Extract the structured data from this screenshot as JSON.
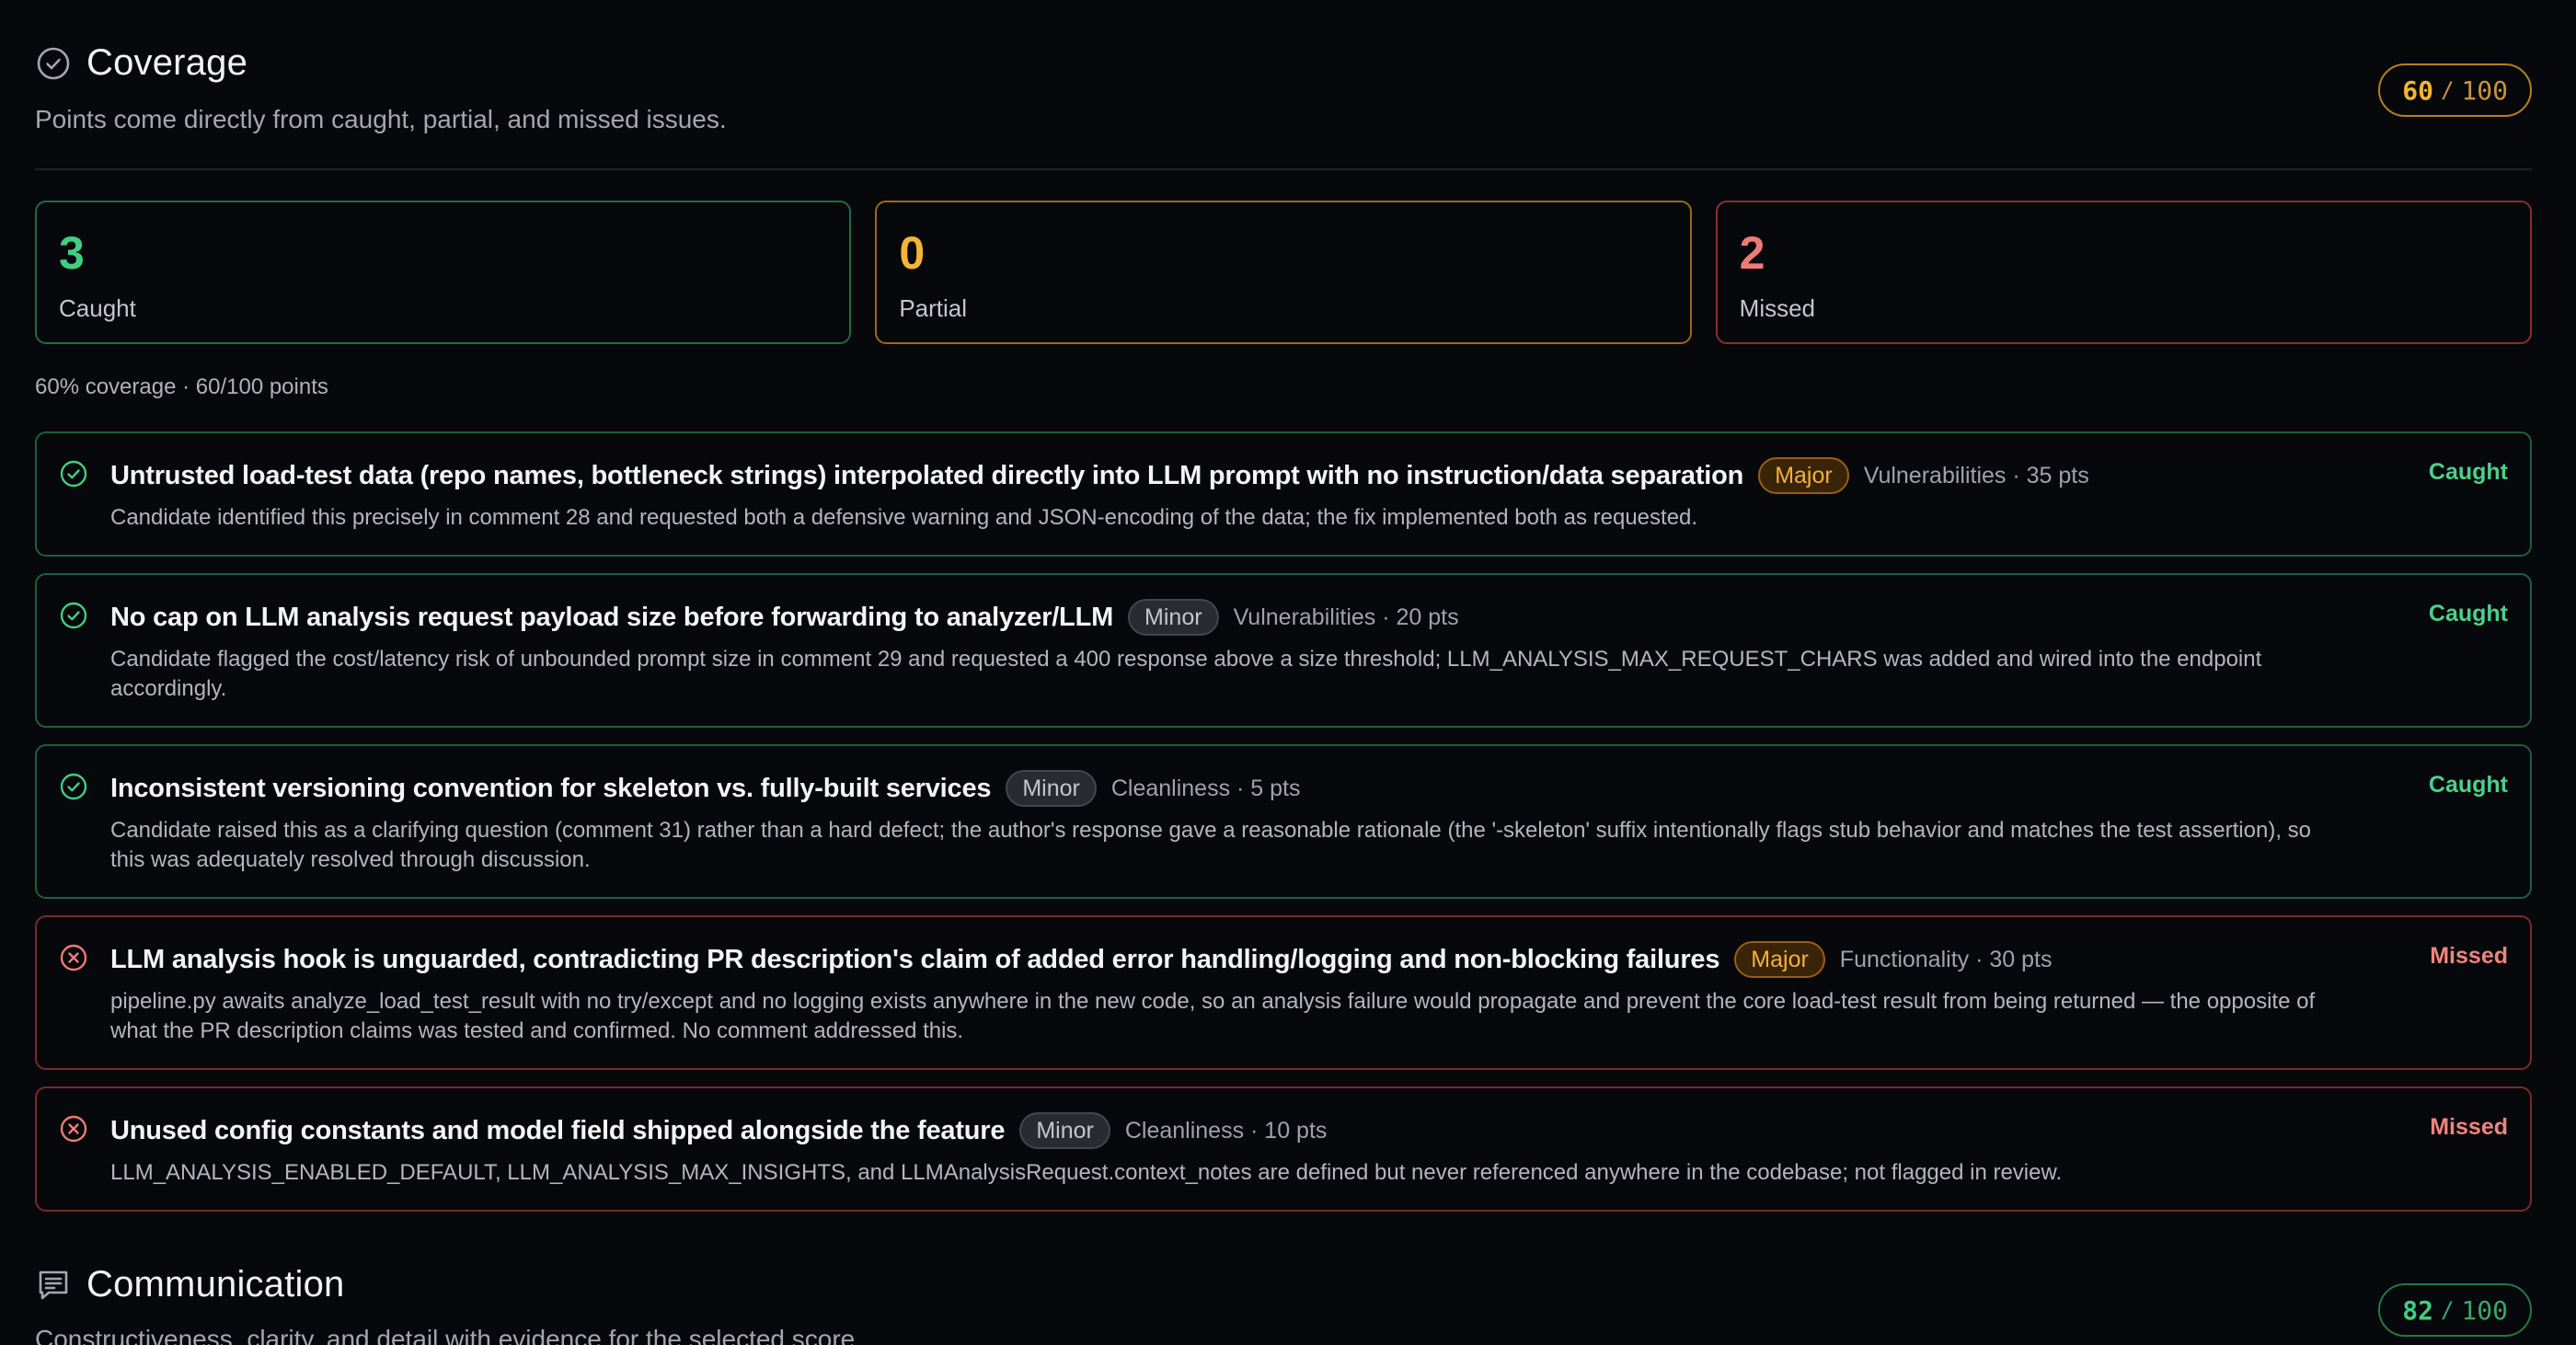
{
  "coverage": {
    "title": "Coverage",
    "subtitle": "Points come directly from caught, partial, and missed issues.",
    "score": "60",
    "score_sep": "/",
    "score_max": "100",
    "stats": [
      {
        "value": "3",
        "label": "Caught"
      },
      {
        "value": "0",
        "label": "Partial"
      },
      {
        "value": "2",
        "label": "Missed"
      }
    ],
    "summary": "60% coverage · 60/100 points",
    "issues": [
      {
        "status": "Caught",
        "title": "Untrusted load-test data (repo names, bottleneck strings) interpolated directly into LLM prompt with no instruction/data separation",
        "severity": "Major",
        "meta": "Vulnerabilities · 35 pts",
        "description": "Candidate identified this precisely in comment 28 and requested both a defensive warning and JSON-encoding of the data; the fix implemented both as requested."
      },
      {
        "status": "Caught",
        "title": "No cap on LLM analysis request payload size before forwarding to analyzer/LLM",
        "severity": "Minor",
        "meta": "Vulnerabilities · 20 pts",
        "description": "Candidate flagged the cost/latency risk of unbounded prompt size in comment 29 and requested a 400 response above a size threshold; LLM_ANALYSIS_MAX_REQUEST_CHARS was added and wired into the endpoint accordingly."
      },
      {
        "status": "Caught",
        "title": "Inconsistent versioning convention for skeleton vs. fully-built services",
        "severity": "Minor",
        "meta": "Cleanliness · 5 pts",
        "description": "Candidate raised this as a clarifying question (comment 31) rather than a hard defect; the author's response gave a reasonable rationale (the '-skeleton' suffix intentionally flags stub behavior and matches the test assertion), so this was adequately resolved through discussion."
      },
      {
        "status": "Missed",
        "title": "LLM analysis hook is unguarded, contradicting PR description's claim of added error handling/logging and non-blocking failures",
        "severity": "Major",
        "meta": "Functionality · 30 pts",
        "description": "pipeline.py awaits analyze_load_test_result with no try/except and no logging exists anywhere in the new code, so an analysis failure would propagate and prevent the core load-test result from being returned — the opposite of what the PR description claims was tested and confirmed. No comment addressed this."
      },
      {
        "status": "Missed",
        "title": "Unused config constants and model field shipped alongside the feature",
        "severity": "Minor",
        "meta": "Cleanliness · 10 pts",
        "description": "LLM_ANALYSIS_ENABLED_DEFAULT, LLM_ANALYSIS_MAX_INSIGHTS, and LLMAnalysisRequest.context_notes are defined but never referenced anywhere in the codebase; not flagged in review."
      }
    ]
  },
  "communication": {
    "title": "Communication",
    "subtitle": "Constructiveness, clarity, and detail with evidence for the selected score.",
    "score": "82",
    "score_sep": "/",
    "score_max": "100"
  },
  "colors": {
    "caught": "#3fcf80",
    "partial": "#f2b534",
    "missed": "#f07a74",
    "background": "#07080b"
  },
  "icons": {
    "coverage": "check-circle-icon",
    "communication": "message-lines-icon",
    "caught": "check-circle-icon",
    "missed": "x-circle-icon"
  }
}
